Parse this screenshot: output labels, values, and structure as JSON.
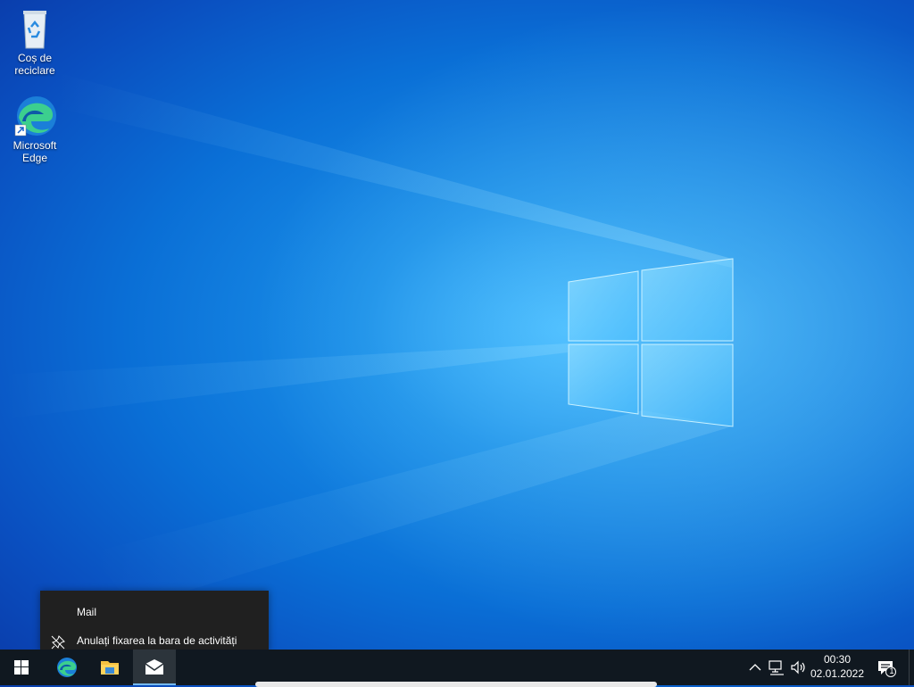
{
  "desktop": {
    "icons": [
      {
        "label": "Coș de\nreciclare",
        "icon": "recycle-bin-icon"
      },
      {
        "label": "Microsoft\nEdge",
        "icon": "edge-icon"
      }
    ]
  },
  "context_menu": {
    "app_title": "Mail",
    "unpin_label": "Anulați fixarea la bara de activități"
  },
  "taskbar": {
    "apps": [
      {
        "name": "start",
        "icon": "windows-logo-icon"
      },
      {
        "name": "edge",
        "icon": "edge-icon"
      },
      {
        "name": "file-explorer",
        "icon": "folder-icon"
      },
      {
        "name": "mail",
        "icon": "mail-icon",
        "active": true
      }
    ],
    "tray": {
      "time": "00:30",
      "date": "02.01.2022",
      "notification_count": "1"
    }
  },
  "colors": {
    "taskbar_bg": "#101820",
    "menu_bg": "#202020",
    "accent": "#76b9ed"
  }
}
